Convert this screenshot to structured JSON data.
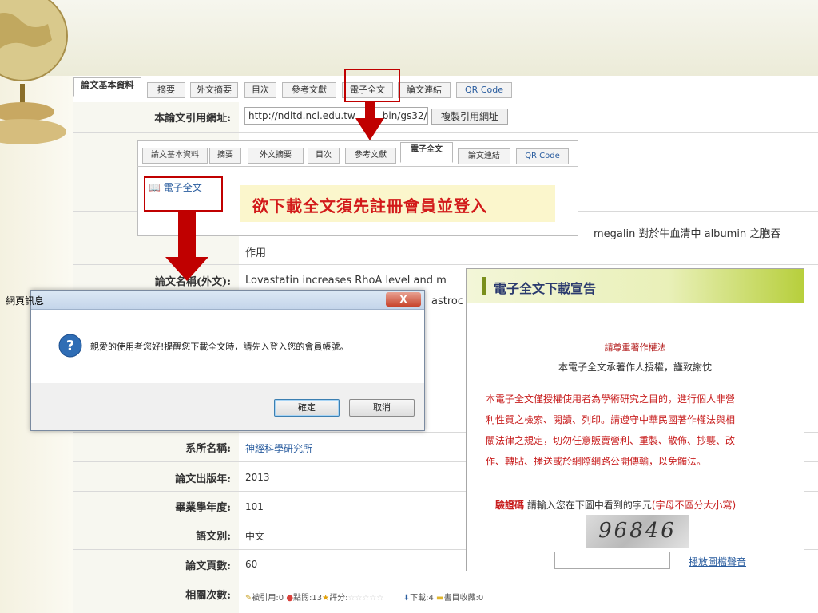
{
  "main_tabs": [
    "論文基本資料",
    "摘要",
    "外文摘要",
    "目次",
    "參考文獻",
    "電子全文",
    "論文連結",
    "QR Code"
  ],
  "citation": {
    "label": "本論文引用網址:",
    "url": "http://ndltd.ncl.edu.tw/cgi-bin/gs32/",
    "url_visible": "http://ndltd.ncl.edu.tw",
    "url_tail": "bin/gs32/",
    "copy_button": "複製引用網址"
  },
  "overlay_tabs": [
    "論文基本資料",
    "摘要",
    "外文摘要",
    "目次",
    "參考文獻",
    "電子全文",
    "論文連結",
    "QR Code"
  ],
  "fulltext_link": "電子全文",
  "register_notice": "欲下載全文須先註冊會員並登入",
  "title_zh_tail": "megalin 對於牛血清中 albumin 之胞吞",
  "title_zh_line2": "作用",
  "title_en": {
    "label": "論文名稱(外文):",
    "line1": "Lovastatin increases RhoA level and m",
    "line2": "astroc"
  },
  "dialog": {
    "title": "網頁訊息",
    "message": "親愛的使用者您好!提醒您下載全文時，請先入登入您的會員帳號。",
    "ok": "確定",
    "cancel": "取消",
    "close": "X"
  },
  "fields": [
    {
      "label": "系所名稱:",
      "value": "神經科學研究所"
    },
    {
      "label": "論文出版年:",
      "value": "2013"
    },
    {
      "label": "畢業學年度:",
      "value": "101"
    },
    {
      "label": "語文別:",
      "value": "中文"
    },
    {
      "label": "論文頁數:",
      "value": "60"
    }
  ],
  "stats": {
    "label": "相關次數:",
    "cited": "被引用:0",
    "views": "點閱:13",
    "rating": "評分:",
    "stars": "☆☆☆☆☆",
    "downloads": "下載:4",
    "bookmarks": "書目收藏:0"
  },
  "declaration": {
    "title": "電子全文下載宣告",
    "respect": "請尊重著作權法",
    "authorized": "本電子全文承著作人授權，謹致謝忱",
    "terms": [
      "本電子全文僅授權使用者為學術研究之目的，進行個人非營",
      "利性質之檢索、閱讀、列印。請遵守中華民國著作權法與相",
      "關法律之規定，切勿任意販賣營利、重製、散佈、抄襲、改",
      "作、轉貼、播送或於網際網路公開傳輸，以免觸法。"
    ],
    "captcha_label": "驗證碼",
    "captcha_prompt": "請輸入您在下圖中看到的字元",
    "captcha_note": "(字母不區分大小寫)",
    "captcha_value": "96846",
    "play_audio": "播放圖檔聲音"
  },
  "colors": {
    "highlight_red": "#c00000",
    "notice_red": "#d21a1a",
    "link_blue": "#2a5d9f",
    "decl_accent": "#b7cf3c"
  }
}
